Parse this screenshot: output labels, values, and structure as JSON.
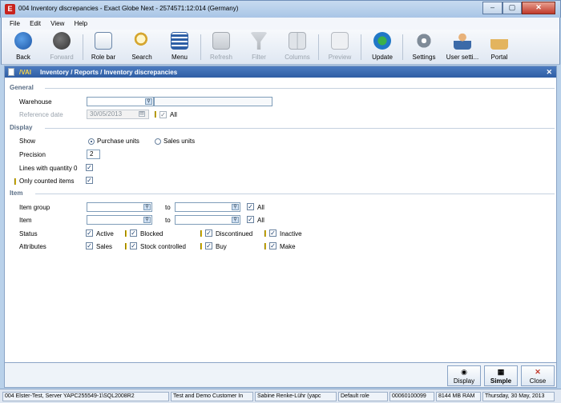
{
  "window": {
    "title": "004 Inventory discrepancies - Exact Globe Next - 2574571:12:014 (Germany)",
    "app_icon_letter": "E",
    "minimize": "‒",
    "maximize": "▢",
    "close": "✕"
  },
  "menubar": [
    "File",
    "Edit",
    "View",
    "Help"
  ],
  "toolbar": {
    "back": "Back",
    "forward": "Forward",
    "rolebar": "Role bar",
    "search": "Search",
    "menu": "Menu",
    "refresh": "Refresh",
    "filter": "Filter",
    "columns": "Columns",
    "preview": "Preview",
    "update": "Update",
    "settings": "Settings",
    "user_settings": "User setti...",
    "portal": "Portal"
  },
  "panel": {
    "code": "/VAI",
    "path": "Inventory / Reports / Inventory discrepancies",
    "close": "✕",
    "general": {
      "section": "General",
      "warehouse_label": "Warehouse",
      "warehouse_value": "",
      "warehouse_desc": "",
      "refdate_label": "Reference date",
      "refdate_value": "30/05/2013",
      "refdate_all": "All",
      "refdate_all_checked": true
    },
    "display": {
      "section": "Display",
      "show_label": "Show",
      "show_options": [
        "Purchase units",
        "Sales units"
      ],
      "show_selected": "Purchase units",
      "precision_label": "Precision",
      "precision_value": "2",
      "lines_qty0_label": "Lines with quantity 0",
      "lines_qty0_checked": true,
      "only_counted_label": "Only counted items",
      "only_counted_checked": true
    },
    "item": {
      "section": "Item",
      "group_label": "Item group",
      "group_from": "",
      "group_to_label": "to",
      "group_to": "",
      "group_all": "All",
      "group_all_checked": true,
      "item_label": "Item",
      "item_from": "",
      "item_to_label": "to",
      "item_to": "",
      "item_all": "All",
      "item_all_checked": true,
      "status_label": "Status",
      "status_options": [
        "Active",
        "Blocked",
        "Discontinued",
        "Inactive"
      ],
      "attributes_label": "Attributes",
      "attribute_options": [
        "Sales",
        "Stock controlled",
        "Buy",
        "Make"
      ]
    }
  },
  "buttons": {
    "display": "Display",
    "simple": "Simple",
    "close": "Close"
  },
  "status": {
    "server": "004 Elster-Test, Server YAPC255549-1\\SQL2008R2",
    "company": "Test and Demo Customer In",
    "user": "Sabine Renke-Lühr (yapc",
    "role": "Default role",
    "id": "00060100099",
    "ram": "8144 MB RAM",
    "date": "Thursday, 30 May, 2013"
  }
}
